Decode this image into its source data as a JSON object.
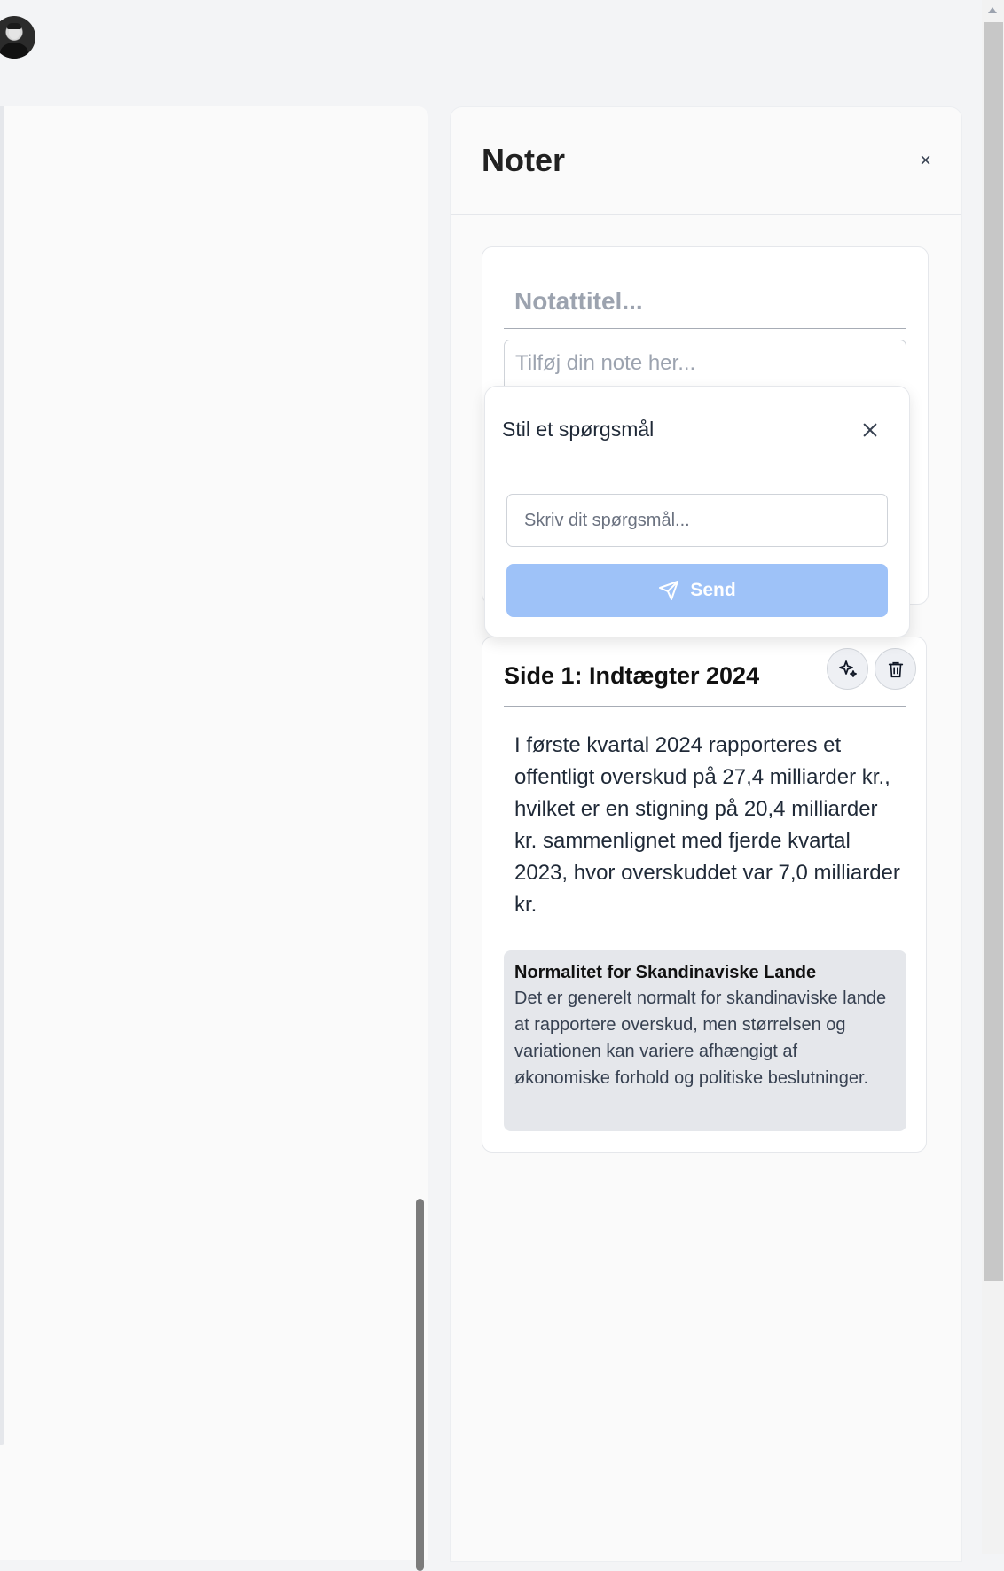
{
  "notes_panel": {
    "title": "Noter",
    "close_label": "×"
  },
  "new_note": {
    "title_placeholder": "Notattitel...",
    "body_placeholder": "Tilføj din note her..."
  },
  "ask_popover": {
    "title": "Stil et spørgsmål",
    "input_placeholder": "Skriv dit spørgsmål...",
    "send_label": "Send"
  },
  "saved_note": {
    "title": "Side 1: Indtægter 2024",
    "body": "I første kvartal 2024 rapporteres et offentligt overskud på 27,4 milliarder kr., hvilket er en stigning på 20,4 milliarder kr. sammenlignet med fjerde kvartal 2023, hvor overskuddet var 7,0 milliarder kr.",
    "insight": {
      "title": "Normalitet for Skandinaviske Lande",
      "text": "Det er generelt normalt for skandinaviske lande at rapportere overskud, men størrelsen og variationen kan variere afhængigt af økonomiske forhold og politiske beslutninger."
    }
  },
  "icons": {
    "ai": "sparkles-icon",
    "delete": "trash-icon",
    "send": "paper-plane-icon",
    "close": "close-icon"
  },
  "colors": {
    "send_button": "#9ec2f8",
    "insight_background": "#e5e7eb"
  }
}
